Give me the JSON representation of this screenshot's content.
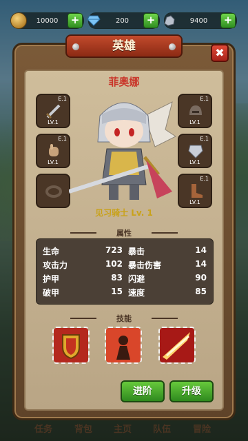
{
  "resources": {
    "gold": {
      "value": "10000",
      "icon": "coin-icon"
    },
    "gems": {
      "value": "200",
      "icon": "gem-icon"
    },
    "ore": {
      "value": "9400",
      "icon": "ore-icon"
    }
  },
  "panel": {
    "title": "英雄",
    "close": "✖"
  },
  "hero": {
    "name": "菲奥娜",
    "rank": "见习骑士 Lv. 1"
  },
  "equipment_left": [
    {
      "tag": "E.1",
      "level": "LV.1",
      "icon": "sword-icon"
    },
    {
      "tag": "E.1",
      "level": "LV.1",
      "icon": "gauntlet-icon"
    },
    {
      "tag": "",
      "level": "",
      "icon": "ring-icon"
    }
  ],
  "equipment_right": [
    {
      "tag": "E.1",
      "level": "LV.1",
      "icon": "helmet-icon"
    },
    {
      "tag": "E.1",
      "level": "LV.1",
      "icon": "armor-icon"
    },
    {
      "tag": "E.1",
      "level": "LV.1",
      "icon": "boots-icon"
    }
  ],
  "attributes": {
    "heading": "属性",
    "left": [
      {
        "label": "生命",
        "value": "723"
      },
      {
        "label": "攻击力",
        "value": "102"
      },
      {
        "label": "护甲",
        "value": "83"
      },
      {
        "label": "破甲",
        "value": "15"
      }
    ],
    "right": [
      {
        "label": "暴击",
        "value": "14"
      },
      {
        "label": "暴击伤害",
        "value": "14"
      },
      {
        "label": "闪避",
        "value": "90"
      },
      {
        "label": "速度",
        "value": "85"
      }
    ]
  },
  "skills": {
    "heading": "技能",
    "items": [
      "shield-skill-icon",
      "berserk-skill-icon",
      "slash-skill-icon"
    ]
  },
  "buttons": {
    "advance": "进阶",
    "upgrade": "升级"
  },
  "nav": [
    "任务",
    "背包",
    "主页",
    "队伍",
    "冒险"
  ]
}
